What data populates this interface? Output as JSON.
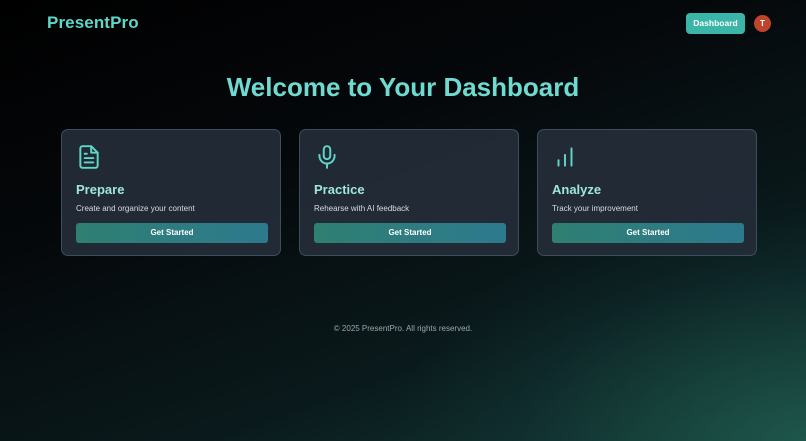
{
  "header": {
    "logo": "PresentPro",
    "dashboard_button": "Dashboard",
    "avatar_initial": "T"
  },
  "hero": {
    "title": "Welcome to Your Dashboard"
  },
  "cards": [
    {
      "icon": "document-icon",
      "title": "Prepare",
      "description": "Create and organize your content",
      "button": "Get Started"
    },
    {
      "icon": "microphone-icon",
      "title": "Practice",
      "description": "Rehearse with AI feedback",
      "button": "Get Started"
    },
    {
      "icon": "bar-chart-icon",
      "title": "Analyze",
      "description": "Track your improvement",
      "button": "Get Started"
    }
  ],
  "footer": {
    "text": "© 2025 PresentPro. All rights reserved."
  },
  "colors": {
    "accent": "#5fd6c8",
    "button": "#3bb5a8",
    "avatar": "#c0432c"
  }
}
